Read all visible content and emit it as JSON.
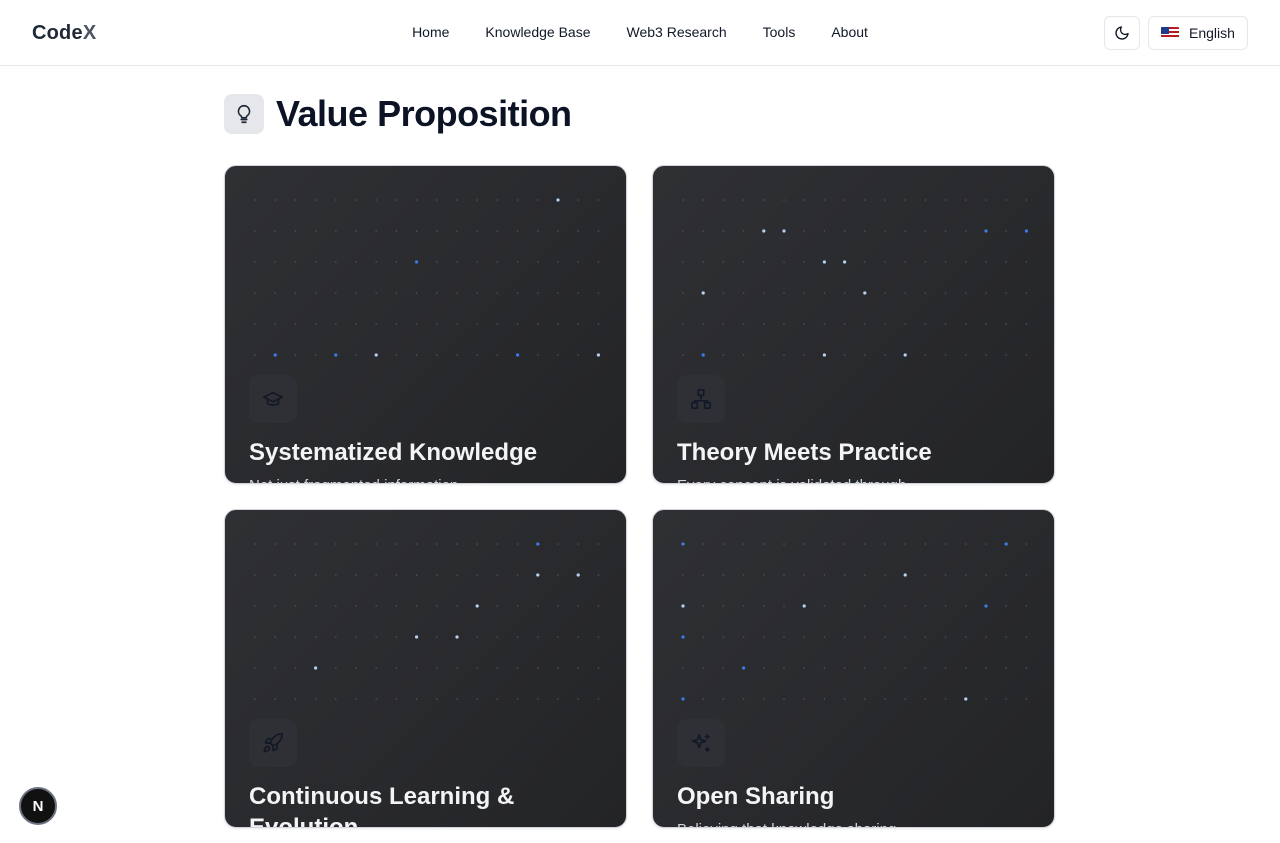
{
  "brand": {
    "name_main": "Code",
    "name_accent": "X"
  },
  "nav": {
    "items": [
      "Home",
      "Knowledge Base",
      "Web3 Research",
      "Tools",
      "About"
    ]
  },
  "header": {
    "theme_icon": "moon-icon",
    "language_label": "English",
    "language_flag": "us-flag-icon"
  },
  "section": {
    "title": "Value Proposition",
    "icon": "lightbulb-icon"
  },
  "cards": [
    {
      "title": "Systematized Knowledge",
      "desc": "Not just fragmented information",
      "icon": "graduation-cap-icon"
    },
    {
      "title": "Theory Meets Practice",
      "desc": "Every concept is validated through",
      "icon": "network-icon"
    },
    {
      "title": "Continuous Learning & Evolution",
      "desc": "",
      "icon": "rocket-icon"
    },
    {
      "title": "Open Sharing",
      "desc": "Believing that knowledge sharing",
      "icon": "sparkles-icon"
    }
  ],
  "badge": {
    "label": "N"
  },
  "colors": {
    "card_bg": "#2a2b2e",
    "dot": "#4b5563",
    "dot_glow": "#60a5fa",
    "title_dark": "#0b1324"
  }
}
